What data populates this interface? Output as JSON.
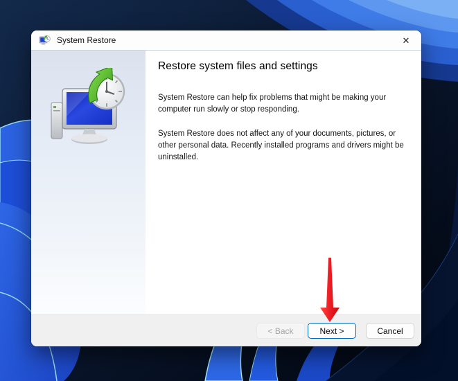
{
  "desktop": {
    "wallpaper": "windows-11-bloom"
  },
  "window": {
    "title": "System Restore",
    "close_glyph": "✕"
  },
  "wizard": {
    "heading": "Restore system files and settings",
    "body_paragraphs": [
      "System Restore can help fix problems that might be making your computer run slowly or stop responding.",
      "System Restore does not affect any of your documents, pictures, or other personal data. Recently installed programs and drivers might be uninstalled."
    ],
    "buttons": {
      "back_label": "< Back",
      "next_label": "Next >",
      "cancel_label": "Cancel",
      "back_enabled": false,
      "next_is_default": true
    }
  },
  "annotation": {
    "type": "red-arrow-down",
    "points_to": "next-button"
  },
  "colors": {
    "accent_blue": "#0067c0",
    "arrow_red": "#e8131d",
    "titlebar_bg": "#fdfdfd",
    "footer_bg": "#f0f0f0",
    "sidebar_top": "#dbe2ee"
  },
  "icons": {
    "titlebar": "system-restore-small-icon",
    "sidebar": "system-restore-clock-icon",
    "close": "close-icon",
    "annotation": "red-down-arrow-icon"
  }
}
